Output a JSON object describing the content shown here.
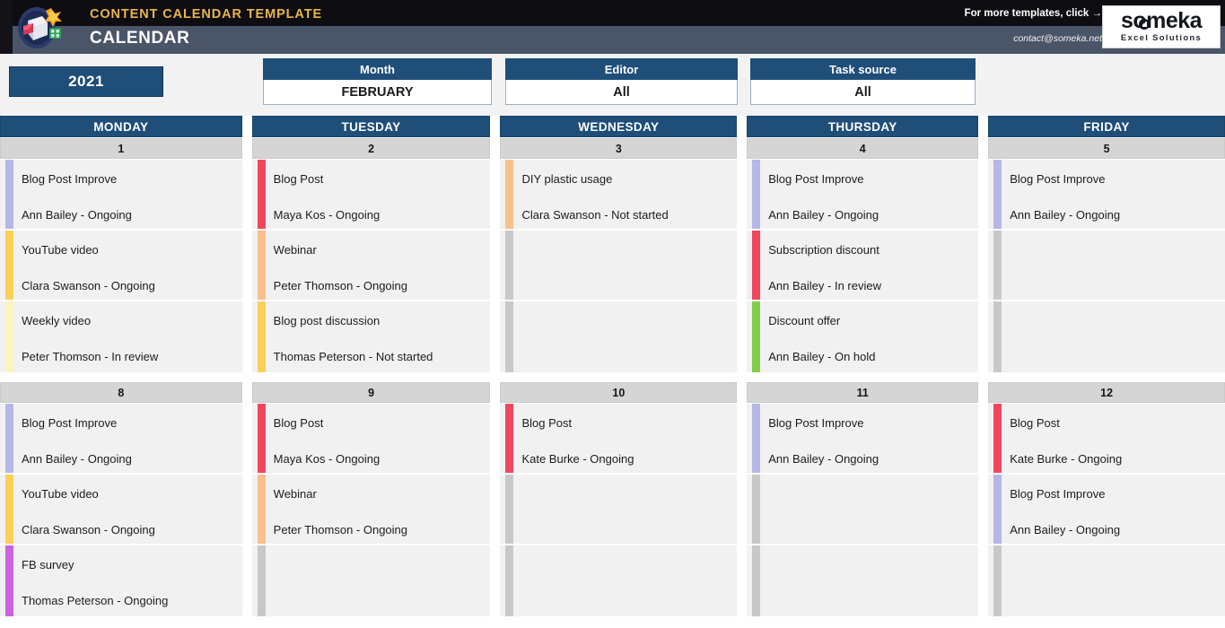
{
  "header": {
    "template_label": "CONTENT CALENDAR TEMPLATE",
    "sheet_title": "CALENDAR",
    "more_templates": "For more templates, click →",
    "contact_email": "contact@someka.net",
    "brand_name": "someka",
    "brand_tagline": "Excel Solutions",
    "logo_icon": "calendar-book-logo-icon"
  },
  "filters": {
    "year": "2021",
    "month": {
      "label": "Month",
      "value": "FEBRUARY"
    },
    "editor": {
      "label": "Editor",
      "value": "All"
    },
    "task_source": {
      "label": "Task source",
      "value": "All"
    }
  },
  "calendar": {
    "day_headers": [
      "MONDAY",
      "TUESDAY",
      "WEDNESDAY",
      "THURSDAY",
      "FRIDAY"
    ],
    "colors": {
      "header_blue": "#1f4e79",
      "daynum_gray": "#d5d5d5",
      "slot_bg": "#f1f1f1",
      "bar_empty": "#c8c8c8",
      "bar_lavender": "#b6b6e8",
      "bar_gold": "#fad05a",
      "bar_pale_yellow": "#fdf3bd",
      "bar_red": "#f0475f",
      "bar_peach": "#f9c08d",
      "bar_green": "#84cd4a",
      "bar_purple": "#cc63de"
    },
    "weeks": [
      {
        "days": [
          {
            "number": "1",
            "tasks": [
              {
                "title": "Blog Post Improve",
                "meta": "Ann Bailey - Ongoing",
                "color": "#b6b6e8"
              },
              {
                "title": "YouTube video",
                "meta": "Clara Swanson - Ongoing",
                "color": "#fad05a"
              },
              {
                "title": "Weekly video",
                "meta": "Peter Thomson - In review",
                "color": "#fdf3bd"
              }
            ]
          },
          {
            "number": "2",
            "tasks": [
              {
                "title": "Blog Post",
                "meta": "Maya Kos - Ongoing",
                "color": "#f0475f"
              },
              {
                "title": "Webinar",
                "meta": "Peter Thomson - Ongoing",
                "color": "#f9c08d"
              },
              {
                "title": "Blog post discussion",
                "meta": "Thomas Peterson - Not started",
                "color": "#fad05a"
              }
            ]
          },
          {
            "number": "3",
            "tasks": [
              {
                "title": "DIY plastic usage",
                "meta": "Clara Swanson - Not started",
                "color": "#f9c08d"
              },
              {
                "title": "",
                "meta": "",
                "color": "#c8c8c8"
              },
              {
                "title": "",
                "meta": "",
                "color": "#c8c8c8"
              }
            ]
          },
          {
            "number": "4",
            "tasks": [
              {
                "title": "Blog Post Improve",
                "meta": "Ann Bailey - Ongoing",
                "color": "#b6b6e8"
              },
              {
                "title": "Subscription discount",
                "meta": "Ann Bailey - In review",
                "color": "#f0475f"
              },
              {
                "title": "Discount offer",
                "meta": "Ann Bailey - On hold",
                "color": "#84cd4a"
              }
            ]
          },
          {
            "number": "5",
            "tasks": [
              {
                "title": "Blog Post Improve",
                "meta": "Ann Bailey - Ongoing",
                "color": "#b6b6e8"
              },
              {
                "title": "",
                "meta": "",
                "color": "#c8c8c8"
              },
              {
                "title": "",
                "meta": "",
                "color": "#c8c8c8"
              }
            ]
          }
        ]
      },
      {
        "days": [
          {
            "number": "8",
            "tasks": [
              {
                "title": "Blog Post Improve",
                "meta": "Ann Bailey - Ongoing",
                "color": "#b6b6e8"
              },
              {
                "title": "YouTube video",
                "meta": "Clara Swanson - Ongoing",
                "color": "#fad05a"
              },
              {
                "title": "FB survey",
                "meta": "Thomas Peterson - Ongoing",
                "color": "#cc63de"
              }
            ]
          },
          {
            "number": "9",
            "tasks": [
              {
                "title": "Blog Post",
                "meta": "Maya Kos - Ongoing",
                "color": "#f0475f"
              },
              {
                "title": "Webinar",
                "meta": "Peter Thomson - Ongoing",
                "color": "#f9c08d"
              },
              {
                "title": "",
                "meta": "",
                "color": "#c8c8c8"
              }
            ]
          },
          {
            "number": "10",
            "tasks": [
              {
                "title": "Blog Post",
                "meta": "Kate Burke - Ongoing",
                "color": "#f0475f"
              },
              {
                "title": "",
                "meta": "",
                "color": "#c8c8c8"
              },
              {
                "title": "",
                "meta": "",
                "color": "#c8c8c8"
              }
            ]
          },
          {
            "number": "11",
            "tasks": [
              {
                "title": "Blog Post Improve",
                "meta": "Ann Bailey - Ongoing",
                "color": "#b6b6e8"
              },
              {
                "title": "",
                "meta": "",
                "color": "#c8c8c8"
              },
              {
                "title": "",
                "meta": "",
                "color": "#c8c8c8"
              }
            ]
          },
          {
            "number": "12",
            "tasks": [
              {
                "title": "Blog Post",
                "meta": "Kate Burke - Ongoing",
                "color": "#f0475f"
              },
              {
                "title": "Blog Post Improve",
                "meta": "Ann Bailey - Ongoing",
                "color": "#b6b6e8"
              },
              {
                "title": "",
                "meta": "",
                "color": "#c8c8c8"
              }
            ]
          }
        ]
      }
    ]
  }
}
